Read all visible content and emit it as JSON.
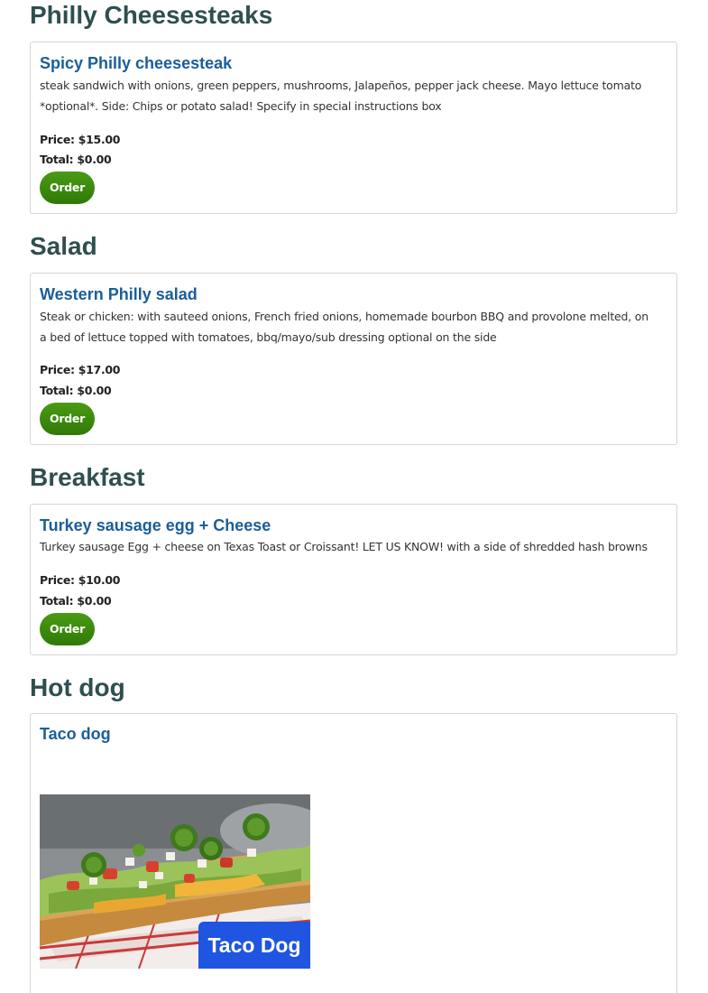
{
  "sections": [
    {
      "title": "Philly Cheesesteaks",
      "item": {
        "name": "Spicy Philly cheesesteak",
        "description_lines": [
          "steak sandwich with onions, green peppers, mushrooms, Jalapeños, pepper jack cheese. Mayo lettuce tomato",
          "*optional*. Side: Chips or potato salad! Specify in special instructions box"
        ],
        "price": "Price: $15.00",
        "total": "Total: $0.00",
        "order_label": "Order"
      }
    },
    {
      "title": "Salad",
      "item": {
        "name": "Western Philly salad",
        "description_lines": [
          "Steak or chicken: with sauteed onions, French fried onions, homemade bourbon BBQ and provolone melted, on",
          "a bed of lettuce topped with tomatoes, bbq/mayo/sub dressing optional on the side"
        ],
        "price": "Price: $17.00",
        "total": "Total: $0.00",
        "order_label": "Order"
      }
    },
    {
      "title": "Breakfast",
      "item": {
        "name": "Turkey sausage egg + Cheese",
        "description_lines": [
          "Turkey sausage Egg + cheese on Texas Toast or Croissant! LET US KNOW! with a side of shredded hash browns"
        ],
        "price": "Price: $10.00",
        "total": "Total: $0.00",
        "order_label": "Order"
      }
    },
    {
      "title": "Hot dog",
      "item": {
        "name": "Taco dog",
        "photo_caption": "Taco Dog"
      }
    }
  ],
  "colors": {
    "section_title": "#2f4f4f",
    "item_title": "#1a5e9a",
    "order_button": "#3f8a0f",
    "photo_caption_bg": "#1f55e0"
  }
}
